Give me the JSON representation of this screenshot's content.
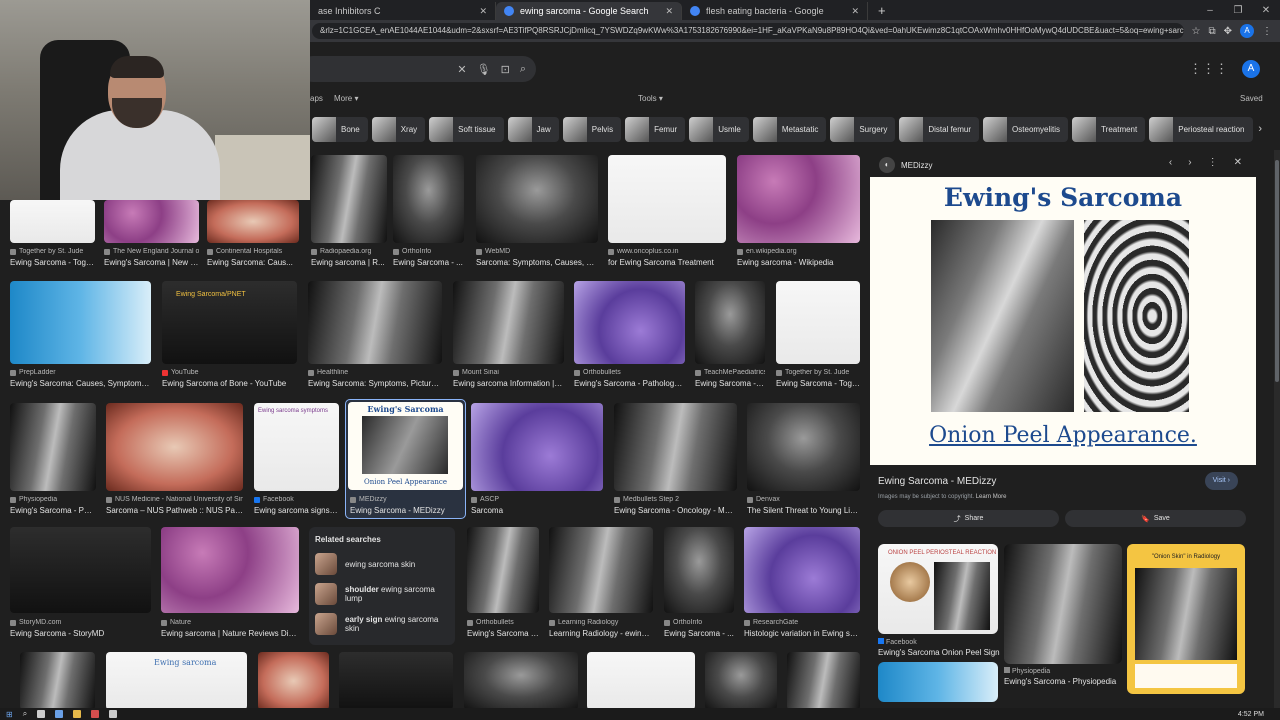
{
  "browser": {
    "tabs": [
      {
        "label": "ase Inhibitors C",
        "active": false
      },
      {
        "label": "ewing sarcoma - Google Search",
        "active": true
      },
      {
        "label": "flesh eating bacteria - Google",
        "active": false
      }
    ],
    "url": "&rlz=1C1GCEA_enAE1044AE1044&udm=2&sxsrf=AE3TifPQ8RSRJCjDmlicq_7YSWDZq9wKWw%3A1753182676990&ei=1HF_aKaVPKaN9u8P89HO4Qi&ved=0ahUKEwimz8C1qtCOAxWmhv0HHfOoMywQ4dUDCBE&uact=5&oq=ewing+sarcoma&gs_lp=EgNpbWciDWV3aW5nIHN..."
  },
  "google": {
    "avatar_letter": "A",
    "nav": {
      "maps": "aps",
      "more": "More ▾",
      "tools": "Tools ▾",
      "saved": "Saved"
    },
    "chips": [
      "Bone",
      "Xray",
      "Soft tissue",
      "Jaw",
      "Pelvis",
      "Femur",
      "Usmle",
      "Metastatic",
      "Surgery",
      "Distal femur",
      "Osteomyelitis",
      "Treatment",
      "Periosteal reaction"
    ]
  },
  "results": {
    "row1": [
      {
        "src": "Together by St. Jude",
        "title": "Ewing Sarcoma - Toge..."
      },
      {
        "src": "The New England Journal of ...",
        "title": "Ewing's Sarcoma | New En..."
      },
      {
        "src": "Continental Hospitals",
        "title": "Ewing Sarcoma: Caus..."
      },
      {
        "src": "Radiopaedia.org",
        "title": "Ewing sarcoma | R..."
      },
      {
        "src": "OrthoInfo",
        "title": "Ewing Sarcoma - ..."
      },
      {
        "src": "WebMD",
        "title": "Sarcoma: Symptoms, Causes, Dia..."
      },
      {
        "src": "www.oncoplus.co.in",
        "title": "for Ewing Sarcoma Treatment"
      },
      {
        "src": "en.wikipedia.org",
        "title": "Ewing sarcoma - Wikipedia"
      }
    ],
    "row2": [
      {
        "src": "PrepLadder",
        "title": "Ewing's Sarcoma: Causes, Symptoms, ..."
      },
      {
        "src": "YouTube",
        "title": "Ewing Sarcoma of Bone - YouTube"
      },
      {
        "src": "Healthline",
        "title": "Ewing Sarcoma: Symptoms, Pictures, ..."
      },
      {
        "src": "Mount Sinai",
        "title": "Ewing sarcoma Information | M..."
      },
      {
        "src": "Orthobullets",
        "title": "Ewing's Sarcoma - Pathology -..."
      },
      {
        "src": "TeachMePaediatrics",
        "title": "Ewing Sarcoma - T..."
      },
      {
        "src": "Together by St. Jude",
        "title": "Ewing Sarcoma - Toge..."
      }
    ],
    "row3": [
      {
        "src": "Physiopedia",
        "title": "Ewing's Sarcoma - Phy..."
      },
      {
        "src": "NUS Medicine - National University of Sing...",
        "title": "Sarcoma – NUS Pathweb :: NUS Path..."
      },
      {
        "src": "Facebook",
        "title": "Ewing sarcoma signs a..."
      },
      {
        "src": "MEDizzy",
        "title": "Ewing Sarcoma - MEDizzy"
      },
      {
        "src": "ASCP",
        "title": "Sarcoma"
      },
      {
        "src": "Medbullets Step 2",
        "title": "Ewing Sarcoma - Oncology - Medb..."
      },
      {
        "src": "Denvax",
        "title": "The Silent Threat to Young Live..."
      }
    ],
    "row4": [
      {
        "src": "StoryMD.com",
        "title": "Ewing Sarcoma - StoryMD"
      },
      {
        "src": "Nature",
        "title": "Ewing sarcoma | Nature Reviews Disea..."
      },
      {
        "src": "Orthobullets",
        "title": "Ewing's Sarcoma - ..."
      },
      {
        "src": "Learning Radiology",
        "title": "Learning Radiology - ewing, ..."
      },
      {
        "src": "OrthoInfo",
        "title": "Ewing Sarcoma - ..."
      },
      {
        "src": "ResearchGate",
        "title": "Histologic variation in Ewing sar..."
      }
    ],
    "row3_texts": {
      "medizzy_title": "Ewing's Sarcoma",
      "medizzy_caption": "Onion Peel Appearance",
      "pnet_title": "Ewing Sarcoma/PNET",
      "symptoms_title": "Ewing sarcoma symptoms",
      "bottom_humerus_text": "Ewing sarcoma"
    }
  },
  "related_searches": {
    "heading": "Related searches",
    "items": [
      {
        "bold_prefix": "",
        "text": "ewing sarcoma skin"
      },
      {
        "bold_prefix": "shoulder",
        "text": " ewing sarcoma lump"
      },
      {
        "bold_prefix": "early sign",
        "text": " ewing sarcoma skin"
      }
    ]
  },
  "preview": {
    "site": "MEDizzy",
    "image_title": "Ewing's Sarcoma",
    "image_caption": "Onion Peel Appearance.",
    "title": "Ewing Sarcoma - MEDizzy",
    "visit": "Visit",
    "copyright": "Images may be subject to copyright.",
    "learn_more": "Learn More",
    "share": "Share",
    "save": "Save",
    "related": [
      {
        "src": "Facebook",
        "title": "Ewing's Sarcoma Onion Peel Sign",
        "label": "ONION PEEL PERIOSTEAL REACTION"
      },
      {
        "src": "Physiopedia",
        "title": "Ewing's Sarcoma - Physiopedia"
      },
      {
        "src": "",
        "title": "",
        "label": "\"Onion Skin\" in Radiology"
      }
    ]
  },
  "taskbar": {
    "time": "4:52 PM"
  },
  "colors": {
    "accent": "#8ab4f8",
    "bg": "#1f1f1f",
    "chip": "#303134",
    "brand_title": "#1d4a8e"
  }
}
